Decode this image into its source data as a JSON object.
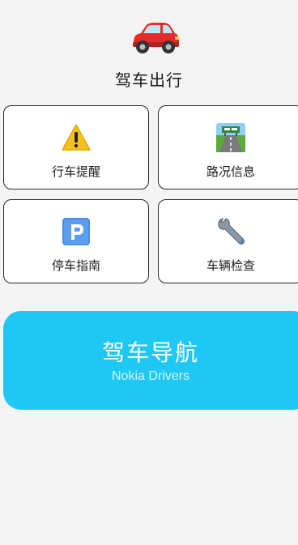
{
  "app": {
    "title": "驾车出行",
    "icon": "car-icon"
  },
  "cards": [
    {
      "label": "行车提醒",
      "icon": "warning-icon"
    },
    {
      "label": "路况信息",
      "icon": "highway-icon"
    },
    {
      "label": "停车指南",
      "icon": "parking-icon"
    },
    {
      "label": "车辆检查",
      "icon": "wrench-icon"
    }
  ],
  "nav": {
    "title": "驾车导航",
    "subtitle": "Nokia Drivers"
  },
  "colors": {
    "accent": "#1fc8f2",
    "background": "#f4f4f5",
    "border": "#2a2a2a"
  }
}
